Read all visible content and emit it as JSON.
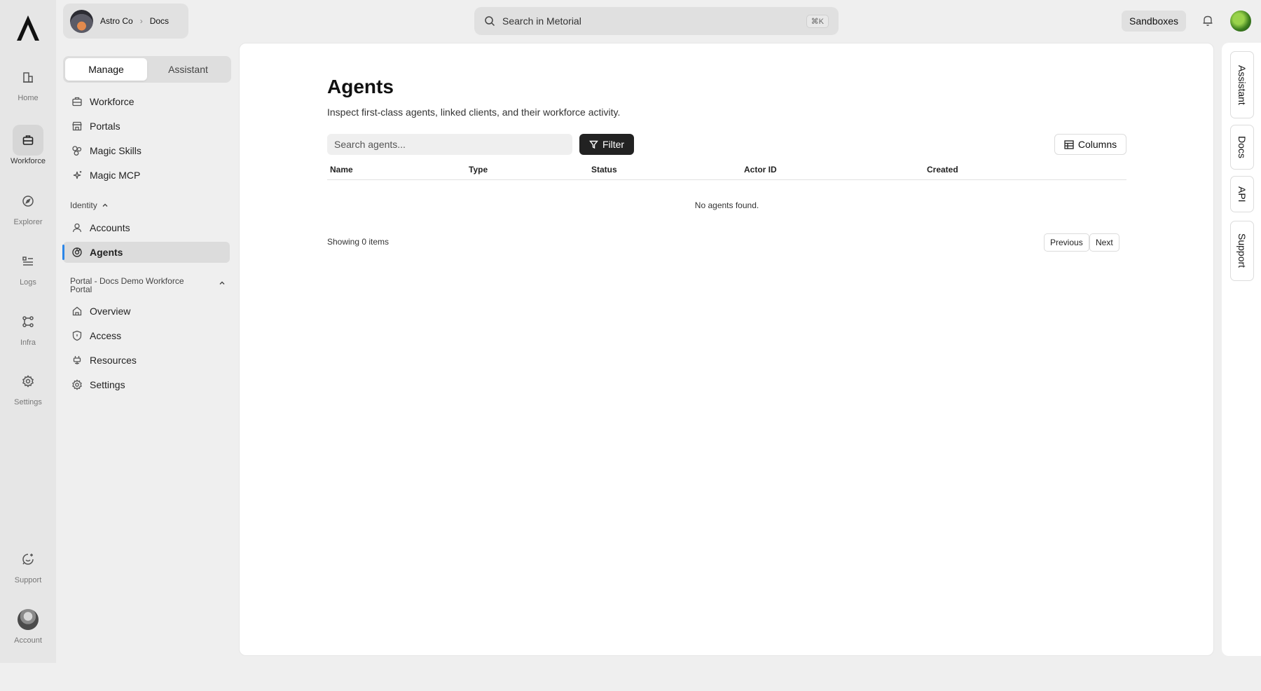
{
  "rail": {
    "items": [
      {
        "label": "Home",
        "icon": "home-icon"
      },
      {
        "label": "Workforce",
        "icon": "briefcase-icon"
      },
      {
        "label": "Explorer",
        "icon": "compass-icon"
      },
      {
        "label": "Logs",
        "icon": "logs-icon"
      },
      {
        "label": "Infra",
        "icon": "infra-icon"
      },
      {
        "label": "Settings",
        "icon": "gear-icon"
      },
      {
        "label": "Support",
        "icon": "support-icon"
      },
      {
        "label": "Account",
        "icon": "avatar"
      }
    ],
    "active": "Workforce"
  },
  "org": {
    "name": "Astro Co",
    "project": "Docs"
  },
  "tabs": {
    "manage": "Manage",
    "assistant": "Assistant"
  },
  "nav": {
    "workforce": "Workforce",
    "portals": "Portals",
    "magic_skills": "Magic Skills",
    "magic_mcp": "Magic MCP",
    "identity_section": "Identity",
    "accounts": "Accounts",
    "agents": "Agents",
    "portal_section": "Portal - Docs Demo Workforce Portal",
    "overview": "Overview",
    "access": "Access",
    "resources": "Resources",
    "settings": "Settings"
  },
  "topbar": {
    "search_placeholder": "Search in Metorial",
    "shortcut": "⌘K",
    "sandboxes": "Sandboxes"
  },
  "page": {
    "title": "Agents",
    "subtitle": "Inspect first-class agents, linked clients, and their workforce activity.",
    "search_placeholder": "Search agents...",
    "filter_label": "Filter",
    "columns_label": "Columns",
    "columns": [
      "Name",
      "Type",
      "Status",
      "Actor ID",
      "Created"
    ],
    "empty_text": "No agents found.",
    "showing_text": "Showing 0 items",
    "prev_label": "Previous",
    "next_label": "Next"
  },
  "right_rail": {
    "tabs": [
      "Assistant",
      "Docs",
      "API",
      "Support"
    ]
  },
  "colors": {
    "accent": "#2c86e8",
    "primary_button": "#222222",
    "background": "#efefef"
  }
}
